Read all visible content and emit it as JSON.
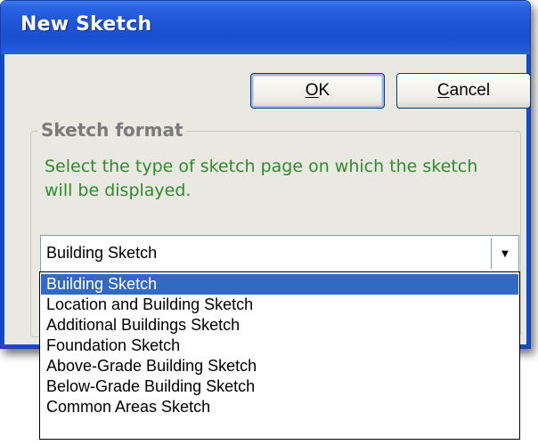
{
  "dialog": {
    "title": "New Sketch"
  },
  "buttons": {
    "ok": {
      "mnemonic": "O",
      "rest": "K"
    },
    "cancel": {
      "mnemonic": "C",
      "rest": "ancel"
    }
  },
  "sketch_format": {
    "legend": "Sketch format",
    "description": "Select the type of sketch page on which the sketch will be displayed.",
    "selected_value": "Building Sketch",
    "dropdown_icon": "chevron-down-icon",
    "options": [
      "Building Sketch",
      "Location and Building Sketch",
      "Additional Buildings Sketch",
      "Foundation Sketch",
      "Above-Grade Building Sketch",
      "Below-Grade Building Sketch",
      "Common Areas Sketch"
    ],
    "highlighted_index": 0
  },
  "colors": {
    "titlebar": "#1e56d6",
    "description_text": "#2e8c2e",
    "selection": "#316ac5"
  }
}
